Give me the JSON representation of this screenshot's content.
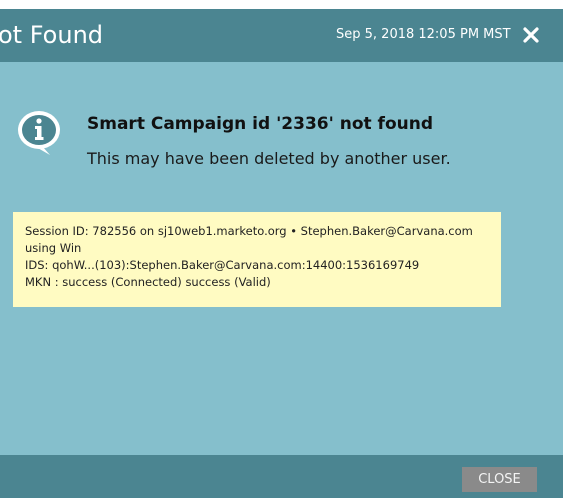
{
  "dialog": {
    "title": "ot Found",
    "timestamp": "Sep 5, 2018 12:05 PM MST",
    "close_icon": "close-icon"
  },
  "message": {
    "icon": "info-icon",
    "title": "Smart Campaign id '2336' not found",
    "body": "This may have been deleted by another user."
  },
  "session": {
    "line1": "Session ID: 782556 on sj10web1.marketo.org • Stephen.Baker@Carvana.com",
    "line2": "using Win",
    "line3": "IDS: qohW...(103):Stephen.Baker@Carvana.com:14400:1536169749",
    "line4": "MKN : success (Connected) success (Valid)"
  },
  "footer": {
    "close_label": "CLOSE"
  },
  "colors": {
    "header": "#4b8591",
    "body": "#85bfcc",
    "session_box": "#fffbc2",
    "close_button": "#8a8a8a"
  }
}
